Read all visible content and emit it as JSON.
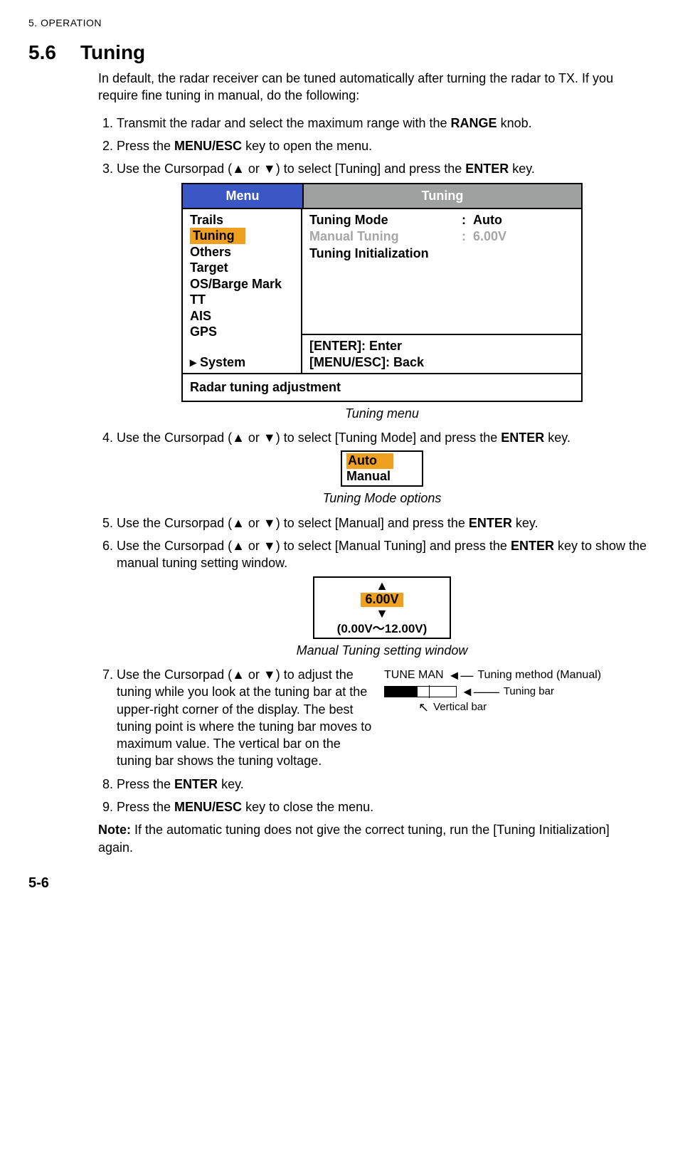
{
  "header": "5.  OPERATION",
  "section": {
    "num": "5.6",
    "title": "Tuning"
  },
  "intro": "In default, the radar receiver can be tuned automatically after turning the radar to TX. If you require fine tuning in manual, do the following:",
  "steps": {
    "s1a": "Transmit the radar and select the maximum range with the ",
    "s1b": "RANGE",
    "s1c": " knob.",
    "s2a": "Press the ",
    "s2b": "MENU/ESC",
    "s2c": " key to open the menu.",
    "s3a": "Use the Cursorpad (",
    "s3b": " or ",
    "s3c": ") to select [Tuning] and press the ",
    "s3d": "ENTER",
    "s3e": " key.",
    "s4a": "Use the Cursorpad (",
    "s4b": " or ",
    "s4c": ") to select [Tuning Mode] and press the ",
    "s4d": "ENTER",
    "s4e": " key.",
    "s5a": "Use the Cursorpad (",
    "s5b": " or ",
    "s5c": ") to select [Manual] and press the ",
    "s5d": "ENTER",
    "s5e": " key.",
    "s6a": "Use the Cursorpad (",
    "s6b": " or ",
    "s6c": ") to select [Manual Tuning] and press the ",
    "s6d": "ENTER",
    "s6e": " key to show the manual tuning setting window.",
    "s7a": "Use the Cursorpad (",
    "s7b": " or ",
    "s7c": ") to adjust the tuning while you look at the tuning bar at the upper-right corner of the display. The best tuning point is where the tuning bar moves to maximum value. The vertical bar on the tuning bar shows the tuning voltage.",
    "s8a": "Press the ",
    "s8b": "ENTER",
    "s8c": " key.",
    "s9a": "Press the ",
    "s9b": "MENU/ESC",
    "s9c": " key to close the menu."
  },
  "menu_fig": {
    "head_left": "Menu",
    "head_right": "Tuning",
    "left_items": [
      "Trails",
      "Tuning",
      "Others",
      "Target",
      "OS/Barge Mark",
      "TT",
      "AIS",
      "GPS"
    ],
    "left_system": "▸ System",
    "right_rows": [
      {
        "label": "Tuning Mode",
        "val": "Auto",
        "dim": false
      },
      {
        "label": "Manual Tuning",
        "val": "6.00V",
        "dim": true
      },
      {
        "label": "Tuning Initialization",
        "val": "",
        "dim": false
      }
    ],
    "help1": "[ENTER]: Enter",
    "help2": "[MENU/ESC]: Back",
    "footer": "Radar tuning adjustment"
  },
  "captions": {
    "cap1": "Tuning menu",
    "cap2": "Tuning Mode options",
    "cap3": "Manual Tuning setting window"
  },
  "opts_fig": {
    "opt1": "Auto",
    "opt2": "Manual"
  },
  "mt_fig": {
    "up": "▲",
    "val": "6.00V",
    "down": "▼",
    "range": "(0.00V～12.00V)"
  },
  "diagram": {
    "tune_label": "TUNE MAN",
    "method_label": "Tuning method (Manual)",
    "bar_label": "Tuning bar",
    "vertical_label": "Vertical bar"
  },
  "note_label": "Note:",
  "note_text": " If the automatic tuning does not give the correct tuning, run the [Tuning Initialization] again.",
  "page_num": "5-6",
  "triangles": {
    "up": "▲",
    "down": "▼"
  }
}
